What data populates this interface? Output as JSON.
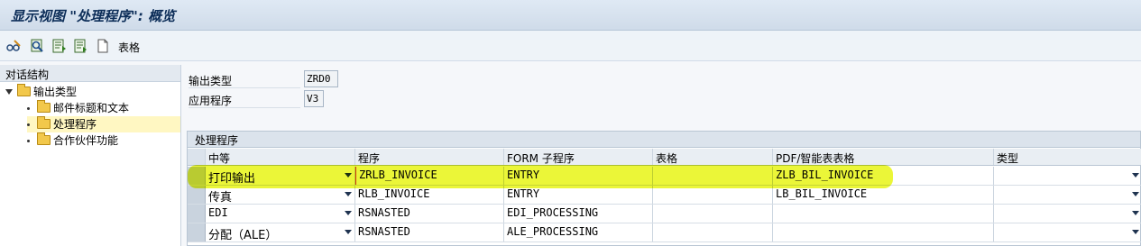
{
  "window": {
    "title": "显示视图 \"处理程序\": 概览"
  },
  "toolbar": {
    "icons": [
      "edit-glasses-icon",
      "display-icon",
      "prev-entry-icon",
      "next-entry-icon",
      "document-icon"
    ],
    "label": "表格"
  },
  "tree": {
    "header": "对话结构",
    "root": {
      "label": "输出类型",
      "icon": "folder-icon"
    },
    "children": [
      {
        "label": "邮件标题和文本",
        "selected": false
      },
      {
        "label": "处理程序",
        "selected": true
      },
      {
        "label": "合作伙伴功能",
        "selected": false
      }
    ]
  },
  "fields": {
    "output_type": {
      "label": "输出类型",
      "value": "ZRD0"
    },
    "application": {
      "label": "应用程序",
      "value": "V3"
    }
  },
  "table": {
    "title": "处理程序",
    "columns": [
      "中等",
      "程序",
      "FORM 子程序",
      "表格",
      "PDF/智能表表格",
      "类型"
    ],
    "rows": [
      {
        "medium": "打印输出",
        "program": "ZRLB_INVOICE",
        "form": "ENTRY",
        "table": "",
        "pdf": "ZLB_BIL_INVOICE",
        "type": ""
      },
      {
        "medium": "传真",
        "program": "RLB_INVOICE",
        "form": "ENTRY",
        "table": "",
        "pdf": "LB_BIL_INVOICE",
        "type": ""
      },
      {
        "medium": "EDI",
        "program": "RSNASTED",
        "form": "EDI_PROCESSING",
        "table": "",
        "pdf": "",
        "type": ""
      },
      {
        "medium": "分配（ALE）",
        "program": "RSNASTED",
        "form": "ALE_PROCESSING",
        "table": "",
        "pdf": "",
        "type": ""
      }
    ],
    "highlight_color": "#e6f400"
  }
}
